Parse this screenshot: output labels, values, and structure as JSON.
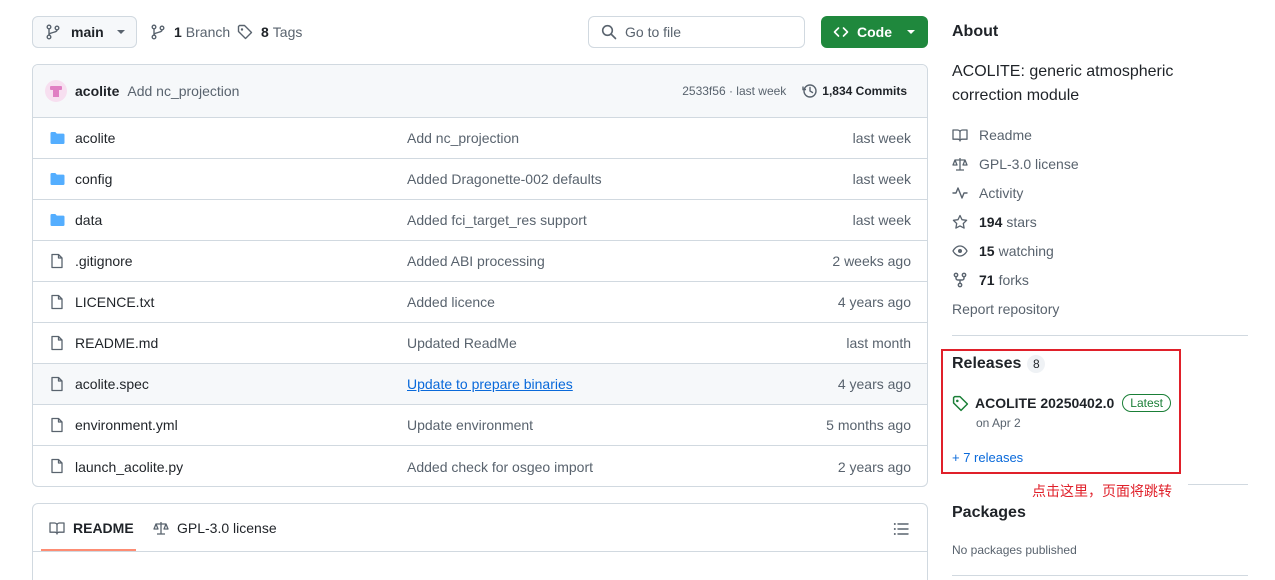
{
  "toolbar": {
    "branch": "main",
    "branches_count": "1",
    "branches_label": "Branch",
    "tags_count": "8",
    "tags_label": "Tags",
    "goto_placeholder": "Go to file",
    "code_label": "Code"
  },
  "commit": {
    "author": "acolite",
    "message": "Add nc_projection",
    "hash_time": "2533f56 · last week",
    "commits_count": "1,834 Commits"
  },
  "files": [
    {
      "type": "folder",
      "name": "acolite",
      "message": "Add nc_projection",
      "date": "last week"
    },
    {
      "type": "folder",
      "name": "config",
      "message": "Added Dragonette-002 defaults",
      "date": "last week"
    },
    {
      "type": "folder",
      "name": "data",
      "message": "Added fci_target_res support",
      "date": "last week"
    },
    {
      "type": "file",
      "name": ".gitignore",
      "message": "Added ABI processing",
      "date": "2 weeks ago"
    },
    {
      "type": "file",
      "name": "LICENCE.txt",
      "message": "Added licence",
      "date": "4 years ago"
    },
    {
      "type": "file",
      "name": "README.md",
      "message": "Updated ReadMe",
      "date": "last month"
    },
    {
      "type": "file",
      "name": "acolite.spec",
      "message": "Update to prepare binaries",
      "date": "4 years ago"
    },
    {
      "type": "file",
      "name": "environment.yml",
      "message": "Update environment",
      "date": "5 months ago"
    },
    {
      "type": "file",
      "name": "launch_acolite.py",
      "message": "Added check for osgeo import",
      "date": "2 years ago"
    }
  ],
  "readme_tabs": {
    "readme": "README",
    "license": "GPL-3.0 license"
  },
  "about": {
    "heading": "About",
    "description": "ACOLITE: generic atmospheric correction module",
    "readme": "Readme",
    "license": "GPL-3.0 license",
    "activity": "Activity",
    "stars_count": "194",
    "stars_label": "stars",
    "watching_count": "15",
    "watching_label": "watching",
    "forks_count": "71",
    "forks_label": "forks",
    "report": "Report repository"
  },
  "releases": {
    "heading": "Releases",
    "count": "8",
    "latest_name": "ACOLITE 20250402.0",
    "latest_badge": "Latest",
    "latest_date": "on Apr 2",
    "more": "+ 7 releases"
  },
  "annotation": "点击这里，页面将跳转",
  "packages": {
    "heading": "Packages",
    "empty": "No packages published"
  },
  "colors": {
    "accent": "#0969da",
    "code_button": "#1f883d",
    "annotation_red": "#e0202a"
  }
}
